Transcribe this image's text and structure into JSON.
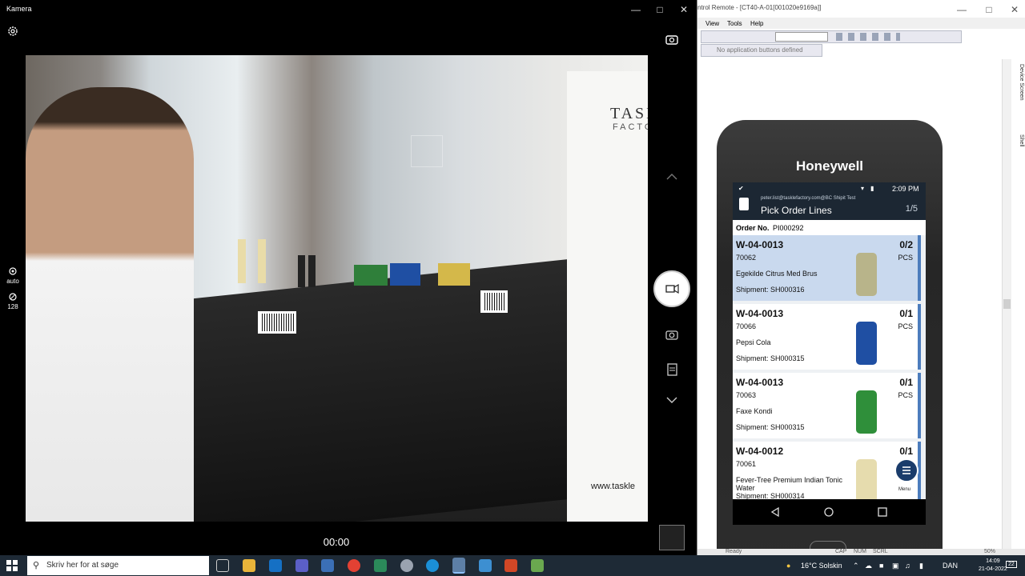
{
  "camera": {
    "title": "Kamera",
    "mode_label": "auto",
    "iso_value": "128",
    "timer": "00:00",
    "viewfinder": {
      "banner_brand": "TASK",
      "banner_brand_sub": "FACTO",
      "banner_url": "www.taskle"
    }
  },
  "remote": {
    "title": "ntrol Remote - [CT40-A-01[001020e9169a]]",
    "menu": [
      "View",
      "Tools",
      "Help"
    ],
    "no_buttons": "No application buttons defined",
    "side_tabs": [
      "Device Screen",
      "Shell"
    ],
    "status": [
      "Ready",
      "CAP",
      "NUM",
      "SCRL",
      "50%"
    ]
  },
  "device": {
    "brand": "Honeywell",
    "status_time": "2:09 PM",
    "account": "peter.list@tasklefactory.com@BC Shipit Test",
    "screen_title": "Pick Order Lines",
    "page_count": "1/5",
    "order_label": "Order No.",
    "order_no": "PI000292",
    "menu_label": "Menu",
    "lines": [
      {
        "location": "W-04-0013",
        "qty": "0/2",
        "item": "70062",
        "uom": "PCS",
        "desc": "Egekilde Citrus Med Brus",
        "shipment": "Shipment: SH000316",
        "can_color": "#b8b48a",
        "selected": true
      },
      {
        "location": "W-04-0013",
        "qty": "0/1",
        "item": "70066",
        "uom": "PCS",
        "desc": "Pepsi Cola",
        "shipment": "Shipment: SH000315",
        "can_color": "#1f4fa3",
        "selected": false
      },
      {
        "location": "W-04-0013",
        "qty": "0/1",
        "item": "70063",
        "uom": "PCS",
        "desc": "Faxe Kondi",
        "shipment": "Shipment: SH000315",
        "can_color": "#2f8f3a",
        "selected": false
      },
      {
        "location": "W-04-0012",
        "qty": "0/1",
        "item": "70061",
        "uom": "",
        "desc": "Fever-Tree Premium Indian Tonic Water",
        "shipment": "Shipment: SH000314",
        "can_color": "#e6dcae",
        "selected": false
      }
    ]
  },
  "taskbar": {
    "search_placeholder": "Skriv her for at søge",
    "weather": "16°C  Solskin",
    "language": "DAN",
    "time": "14:09",
    "date": "21-04-2022",
    "notifications": "22"
  },
  "colors": {
    "accent": "#4c7dbd",
    "app_header": "#1c2733",
    "taskbar": "#1e2a36"
  }
}
